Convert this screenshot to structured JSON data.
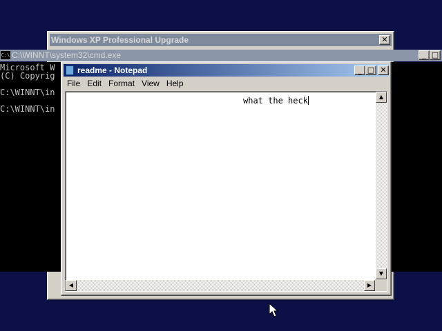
{
  "upgrade_window": {
    "title": "Windows XP Professional Upgrade"
  },
  "cmd_window": {
    "title": "C:\\WINNT\\system32\\cmd.exe",
    "icon_label": "C:\\",
    "lines": [
      "Microsoft W",
      "(C) Copyrig",
      "",
      "C:\\WINNT\\in",
      "",
      "C:\\WINNT\\in"
    ]
  },
  "notepad": {
    "title": "readme - Notepad",
    "menu": [
      "File",
      "Edit",
      "Format",
      "View",
      "Help"
    ],
    "content": "what the heck"
  },
  "buttons": {
    "close": "✕",
    "minimize": "_",
    "maximize": "□"
  },
  "colors": {
    "desktop": "#0c1047",
    "active_title": "#0a246a",
    "inactive_title": "#7f8a9c"
  }
}
